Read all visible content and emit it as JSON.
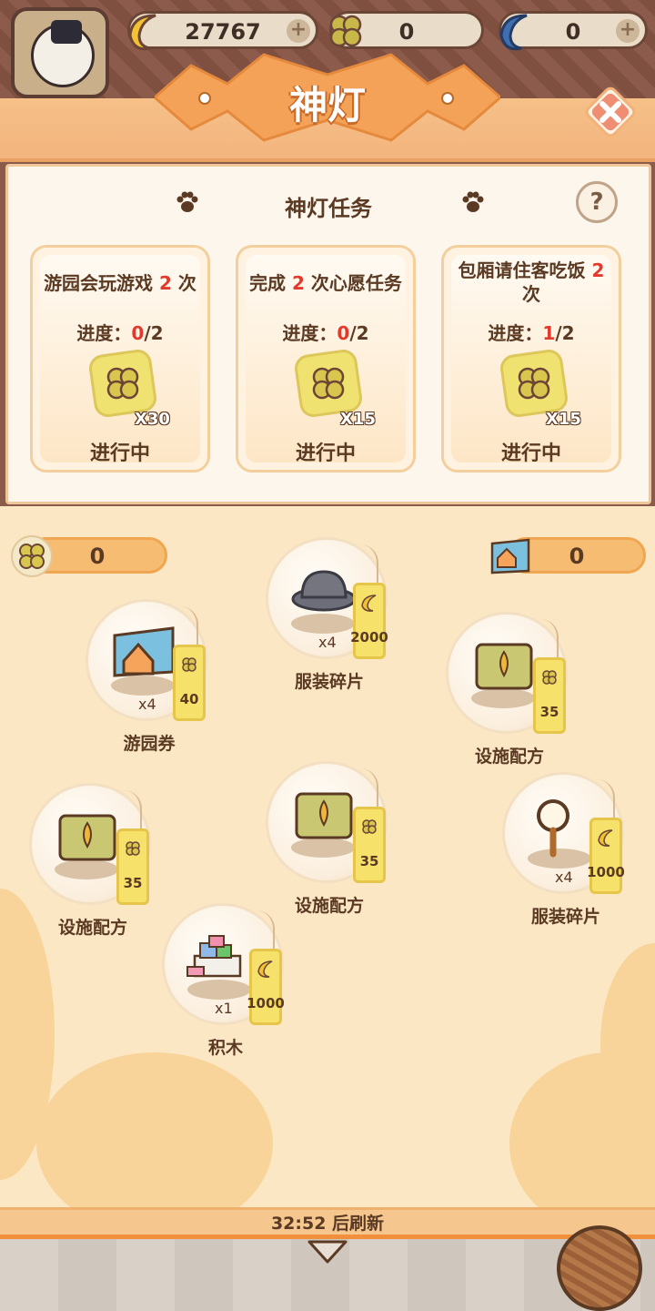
{
  "currencies": [
    {
      "name": "banana",
      "value": "27767",
      "icon": "banana-icon"
    },
    {
      "name": "clover",
      "value": "0",
      "icon": "clover-icon"
    },
    {
      "name": "blue-banana",
      "value": "0",
      "icon": "blue-banana-icon"
    }
  ],
  "header": {
    "title": "神灯"
  },
  "panel": {
    "title": "神灯任务",
    "help_label": "?",
    "tasks": [
      {
        "desc_pre": "游园会玩游戏 ",
        "desc_num": "2",
        "desc_post": " 次",
        "prog_label": "进度：",
        "prog_done": "0",
        "prog_total": "/2",
        "reward_count": "X30",
        "status": "进行中"
      },
      {
        "desc_pre": "完成 ",
        "desc_num": "2",
        "desc_post": " 次心愿任务",
        "prog_label": "进度：",
        "prog_done": "0",
        "prog_total": "/2",
        "reward_count": "X15",
        "status": "进行中"
      },
      {
        "desc_pre": "包厢请住客吃饭 ",
        "desc_num": "2",
        "desc_post": " 次",
        "prog_label": "进度：",
        "prog_done": "1",
        "prog_total": "/2",
        "reward_count": "X15",
        "status": "进行中"
      }
    ]
  },
  "shop": {
    "clover_balance": "0",
    "ticket_balance": "0",
    "items": [
      {
        "name": "服装碎片",
        "qty": "x4",
        "price": "2000",
        "currency": "banana",
        "art": "hat"
      },
      {
        "name": "游园券",
        "qty": "x4",
        "price": "40",
        "currency": "clover",
        "art": "ticket"
      },
      {
        "name": "设施配方",
        "qty": "",
        "price": "35",
        "currency": "clover",
        "art": "scroll"
      },
      {
        "name": "设施配方",
        "qty": "",
        "price": "35",
        "currency": "clover",
        "art": "scroll"
      },
      {
        "name": "设施配方",
        "qty": "",
        "price": "35",
        "currency": "clover",
        "art": "scroll"
      },
      {
        "name": "服装碎片",
        "qty": "x4",
        "price": "1000",
        "currency": "banana",
        "art": "magnifier"
      },
      {
        "name": "积木",
        "qty": "x1",
        "price": "1000",
        "currency": "banana",
        "art": "blocks"
      }
    ]
  },
  "footer": {
    "refresh_text": "32:52 后刷新"
  }
}
